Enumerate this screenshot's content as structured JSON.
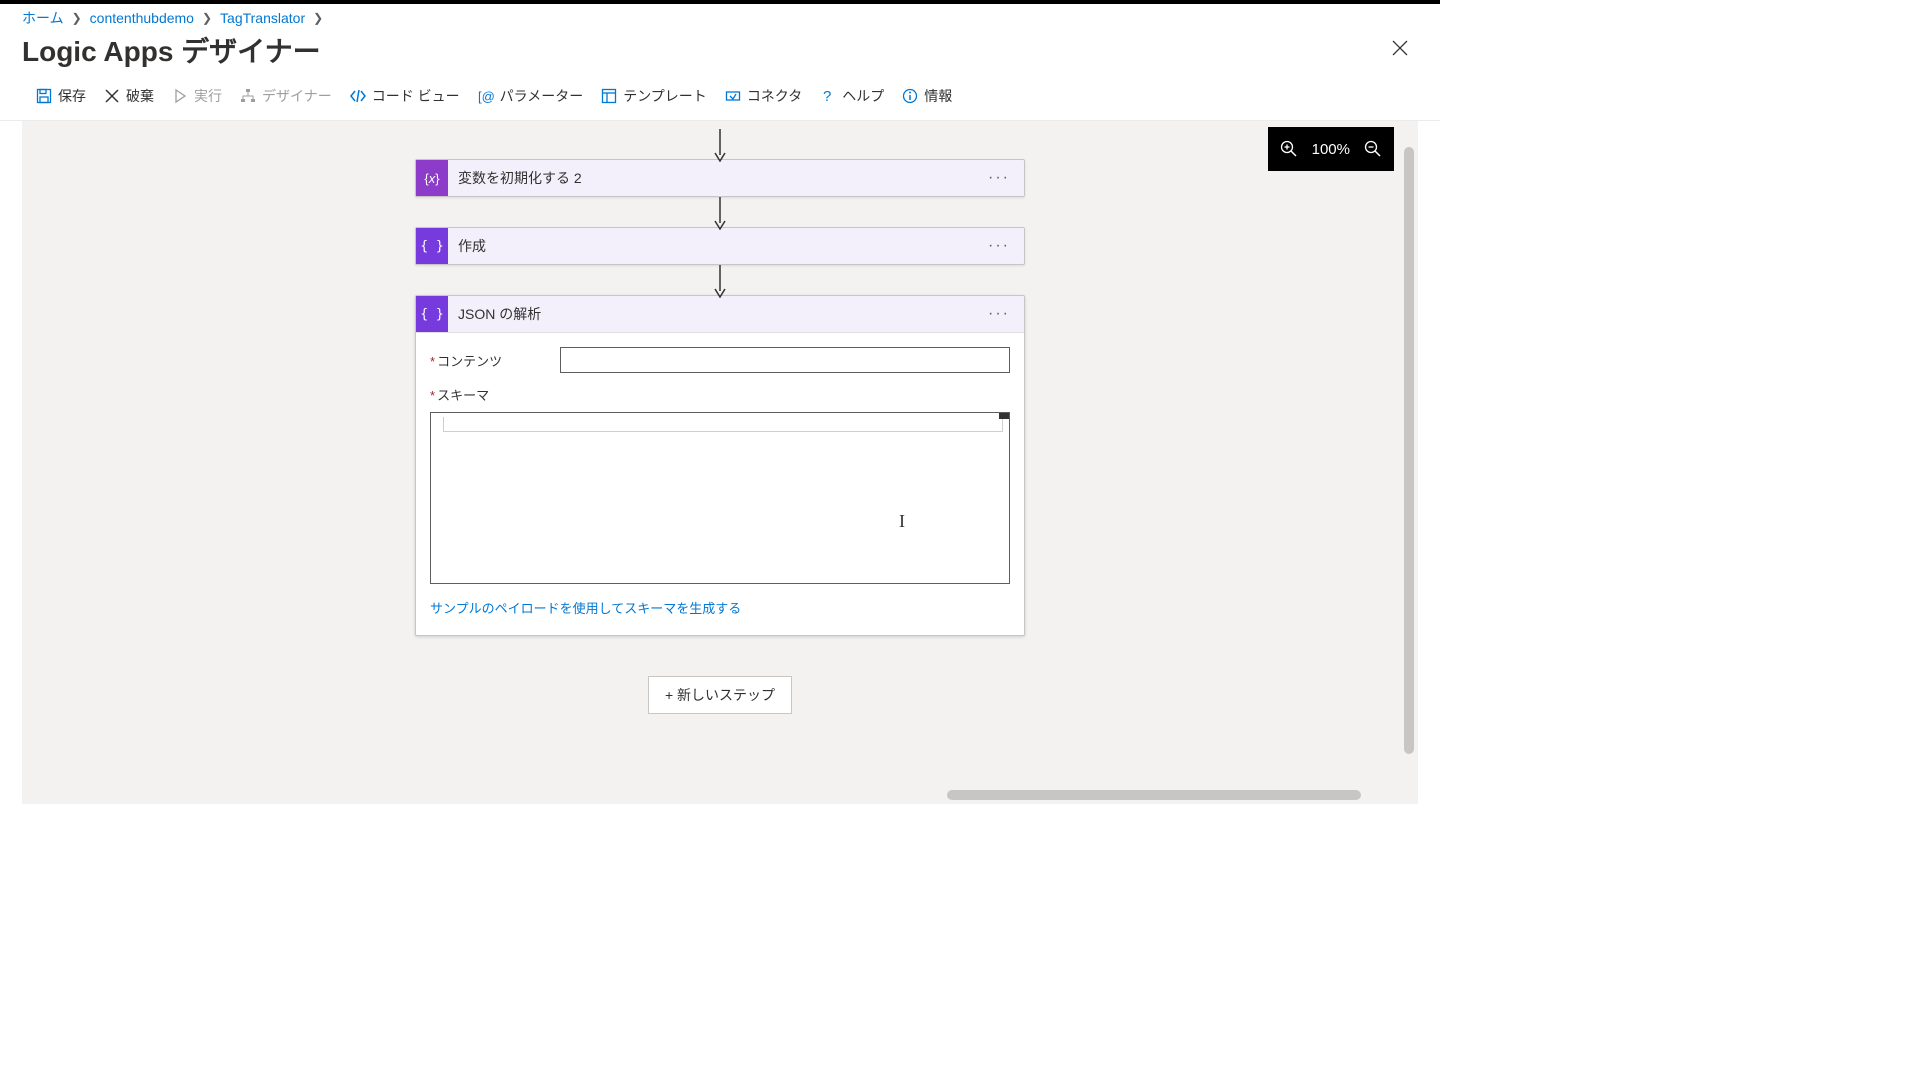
{
  "breadcrumb": {
    "home": "ホーム",
    "item1": "contenthubdemo",
    "item2": "TagTranslator"
  },
  "page_title": "Logic Apps デザイナー",
  "toolbar": {
    "save": "保存",
    "discard": "破棄",
    "run": "実行",
    "designer": "デザイナー",
    "code_view": "コード ビュー",
    "parameters": "パラメーター",
    "templates": "テンプレート",
    "connectors": "コネクタ",
    "help": "ヘルプ",
    "info": "情報"
  },
  "zoom_value": "100%",
  "steps": {
    "init_var": "変数を初期化する 2",
    "compose": "作成",
    "parse_json": {
      "title": "JSON の解析",
      "field_content": "コンテンツ",
      "field_schema": "スキーマ",
      "gen_link": "サンプルのペイロードを使用してスキーマを生成する"
    }
  },
  "new_step": "+ 新しいステップ"
}
